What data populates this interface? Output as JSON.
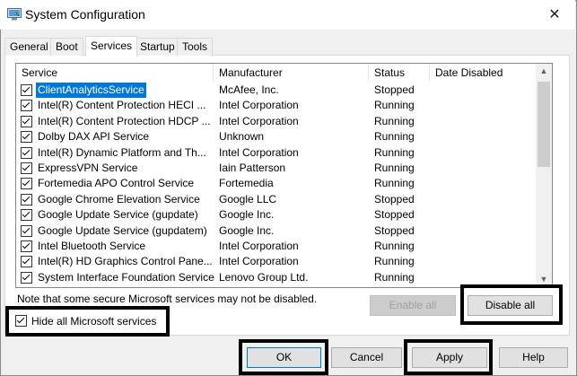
{
  "window": {
    "title": "System Configuration",
    "close_glyph": "✕"
  },
  "tabs": [
    "General",
    "Boot",
    "Services",
    "Startup",
    "Tools"
  ],
  "active_tab": "Services",
  "columns": [
    "Service",
    "Manufacturer",
    "Status",
    "Date Disabled"
  ],
  "services": [
    {
      "name": "ClientAnalyticsService",
      "manufacturer": "McAfee, Inc.",
      "status": "Stopped",
      "date_disabled": "",
      "checked": true,
      "selected": true
    },
    {
      "name": "Intel(R) Content Protection HECI ...",
      "manufacturer": "Intel Corporation",
      "status": "Running",
      "date_disabled": "",
      "checked": true
    },
    {
      "name": "Intel(R) Content Protection HDCP ...",
      "manufacturer": "Intel Corporation",
      "status": "Running",
      "date_disabled": "",
      "checked": true
    },
    {
      "name": "Dolby DAX API Service",
      "manufacturer": "Unknown",
      "status": "Running",
      "date_disabled": "",
      "checked": true
    },
    {
      "name": "Intel(R) Dynamic Platform and Th...",
      "manufacturer": "Intel Corporation",
      "status": "Running",
      "date_disabled": "",
      "checked": true
    },
    {
      "name": "ExpressVPN Service",
      "manufacturer": "Iain Patterson",
      "status": "Running",
      "date_disabled": "",
      "checked": true
    },
    {
      "name": "Fortemedia APO Control Service",
      "manufacturer": "Fortemedia",
      "status": "Running",
      "date_disabled": "",
      "checked": true
    },
    {
      "name": "Google Chrome Elevation Service",
      "manufacturer": "Google LLC",
      "status": "Stopped",
      "date_disabled": "",
      "checked": true
    },
    {
      "name": "Google Update Service (gupdate)",
      "manufacturer": "Google Inc.",
      "status": "Stopped",
      "date_disabled": "",
      "checked": true
    },
    {
      "name": "Google Update Service (gupdatem)",
      "manufacturer": "Google Inc.",
      "status": "Stopped",
      "date_disabled": "",
      "checked": true
    },
    {
      "name": "Intel Bluetooth Service",
      "manufacturer": "Intel Corporation",
      "status": "Running",
      "date_disabled": "",
      "checked": true
    },
    {
      "name": "Intel(R) HD Graphics Control Pane...",
      "manufacturer": "Intel Corporation",
      "status": "Running",
      "date_disabled": "",
      "checked": true
    },
    {
      "name": "System Interface Foundation Service",
      "manufacturer": "Lenovo Group Ltd.",
      "status": "Running",
      "date_disabled": "",
      "checked": true
    }
  ],
  "note": "Note that some secure Microsoft services may not be disabled.",
  "buttons": {
    "enable_all": "Enable all",
    "disable_all": "Disable all",
    "ok": "OK",
    "cancel": "Cancel",
    "apply": "Apply",
    "help": "Help"
  },
  "hide_ms": {
    "label": "Hide all Microsoft services",
    "checked": true
  },
  "colors": {
    "selection": "#0078d7",
    "highlight_box": "#000000"
  }
}
